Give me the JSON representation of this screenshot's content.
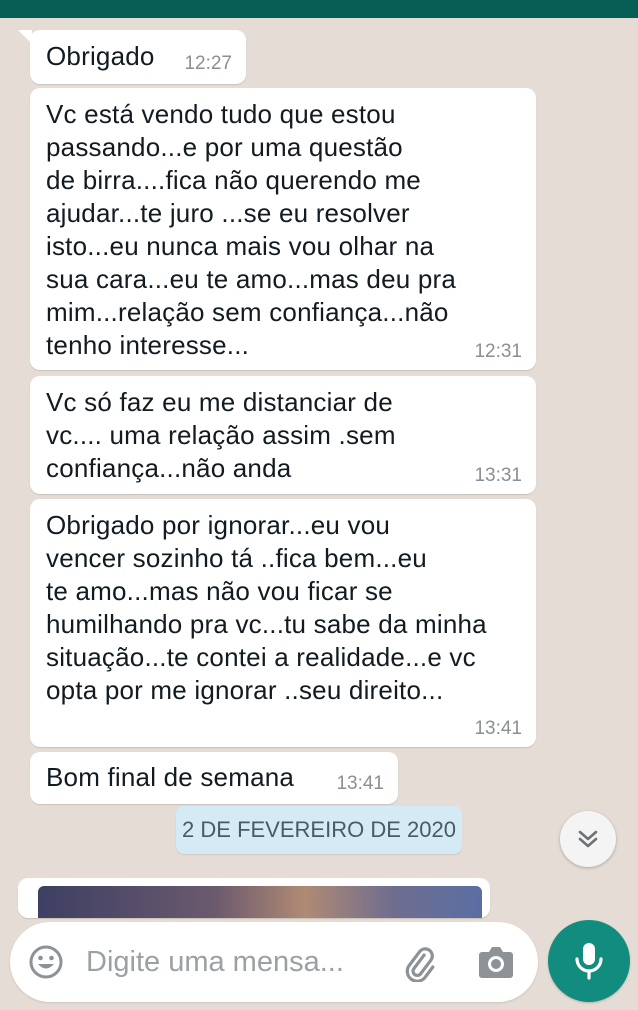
{
  "colors": {
    "chat_background": "#e5ddd5",
    "header": "#075e54",
    "bubble": "#ffffff",
    "date_pill": "#d4eaf4",
    "mic_button": "#128c7e"
  },
  "messages": [
    {
      "text": "Obrigado",
      "time": "12:27"
    },
    {
      "text": "Vc está vendo tudo que estou\npassando...e por uma questão\nde birra....fica não querendo me\najudar...te juro ...se eu resolver\nisto...eu nunca mais vou olhar na\nsua cara...eu te amo...mas deu pra\nmim...relação sem confiança...não\ntenho interesse...",
      "time": "12:31"
    },
    {
      "text": "Vc só faz eu me distanciar de\nvc.... uma relação assim .sem\nconfiança...não anda",
      "time": "13:31"
    },
    {
      "text": "Obrigado por ignorar...eu vou\nvencer sozinho tá ..fica bem...eu\nte amo...mas não vou ficar se\nhumilhando pra vc...tu sabe da minha\nsituação...te contei a realidade...e vc\nopta por me ignorar ..seu direito...",
      "time": "13:41"
    },
    {
      "text": "Bom final de semana",
      "time": "13:41"
    }
  ],
  "date_separator": "2 DE FEVEREIRO DE 2020",
  "composer": {
    "placeholder": "Digite uma mensa...",
    "emoji_icon": "emoji-icon",
    "attach_icon": "paperclip-icon",
    "camera_icon": "camera-icon",
    "mic_icon": "microphone-icon"
  },
  "scroll_down_icon": "double-chevron-down-icon"
}
